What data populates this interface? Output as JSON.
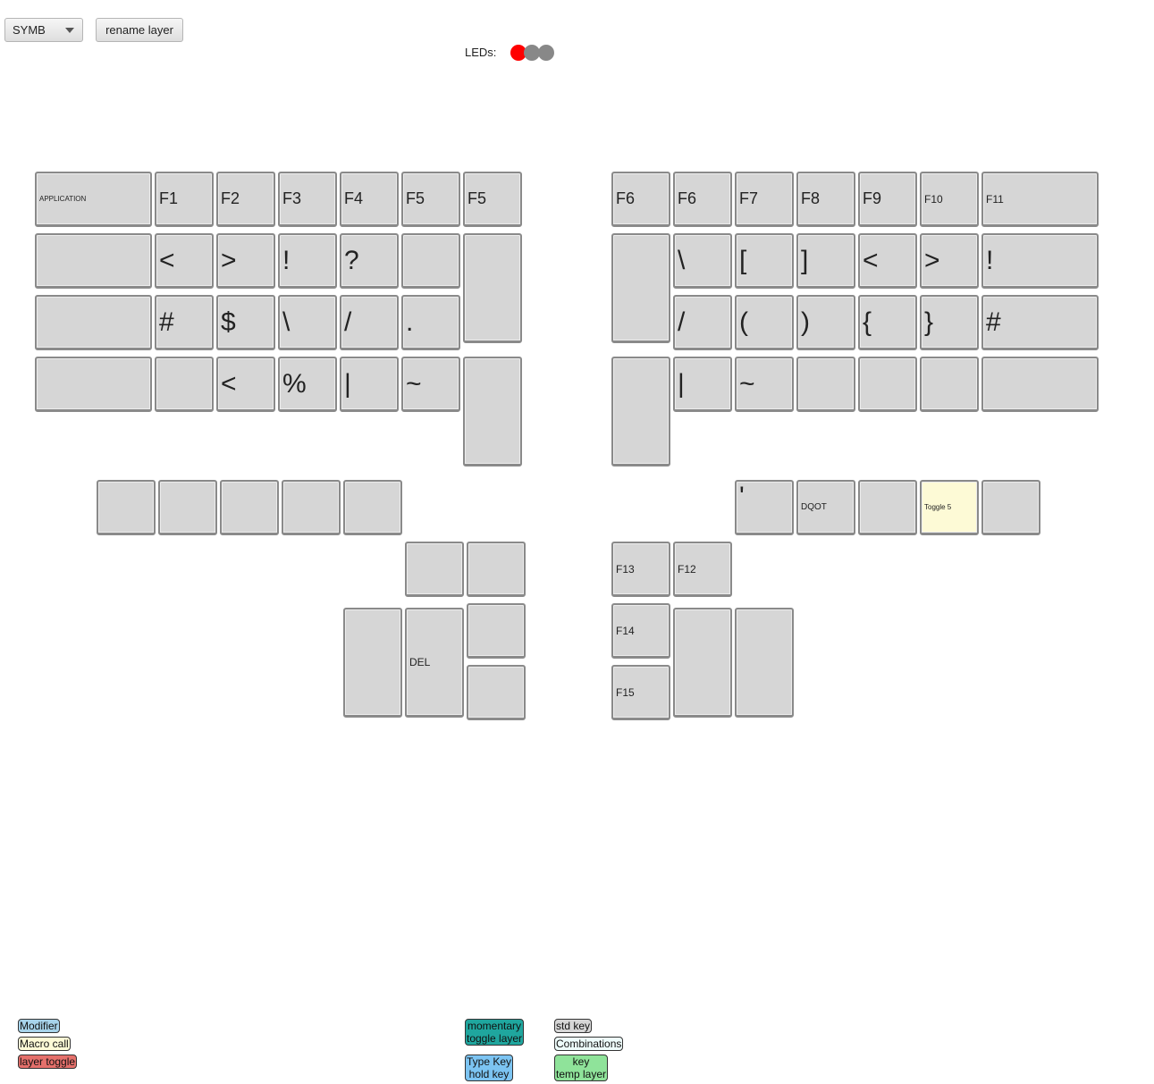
{
  "toolbar": {
    "layer_select_value": "SYMB",
    "rename_label": "rename layer",
    "leds_label": "LEDs:"
  },
  "leds": [
    {
      "name": "led-1",
      "color": "#ff0000"
    },
    {
      "name": "led-2",
      "color": "#888888"
    },
    {
      "name": "led-3",
      "color": "#888888"
    }
  ],
  "keys": {
    "l_r1_c1": "APPLICATION",
    "l_r1_c2": "F1",
    "l_r1_c3": "F2",
    "l_r1_c4": "F3",
    "l_r1_c5": "F4",
    "l_r1_c6": "F5",
    "l_r1_c7": "F5",
    "r_r1_c1": "F6",
    "r_r1_c2": "F6",
    "r_r1_c3": "F7",
    "r_r1_c4": "F8",
    "r_r1_c5": "F9",
    "r_r1_c6": "F10",
    "r_r1_c7": "F11",
    "l_r2_c1": "",
    "l_r2_c2": "<",
    "l_r2_c3": ">",
    "l_r2_c4": "!",
    "l_r2_c5": "?",
    "l_r2_c6": "",
    "l_r2_c7": "",
    "r_r2_c1": "",
    "r_r2_c2": "\\",
    "r_r2_c3": "[",
    "r_r2_c4": "]",
    "r_r2_c5": "<",
    "r_r2_c6": ">",
    "r_r2_c7": "!",
    "l_r3_c1": "",
    "l_r3_c2": "#",
    "l_r3_c3": "$",
    "l_r3_c4": "\\",
    "l_r3_c5": "/",
    "l_r3_c6": ".",
    "r_r3_c2": "/",
    "r_r3_c3": "(",
    "r_r3_c4": ")",
    "r_r3_c5": "{",
    "r_r3_c6": "}",
    "r_r3_c7": "#",
    "l_r4_c1": "",
    "l_r4_c2": "",
    "l_r4_c3": "<",
    "l_r4_c4": "%",
    "l_r4_c5": "|",
    "l_r4_c6": "~",
    "l_r4_c7": "",
    "r_r4_c1": "",
    "r_r4_c2": "|",
    "r_r4_c3": "~",
    "r_r4_c4": "",
    "r_r4_c5": "",
    "r_r4_c6": "",
    "r_r4_c7": "",
    "l_b_c1": "",
    "l_b_c2": "",
    "l_b_c3": "",
    "l_b_c4": "",
    "l_b_c5": "",
    "r_b_c1": "'",
    "r_b_c2": "DQOT",
    "r_b_c3": "",
    "r_b_c4": "Toggle 5",
    "r_b_c5": "",
    "l_t1": "",
    "l_t2": "",
    "l_t3": "",
    "l_t4": "DEL",
    "l_t5": "",
    "l_t6": "",
    "r_t1": "F13",
    "r_t2": "F12",
    "r_t3": "F14",
    "r_t4": "",
    "r_t5": "",
    "r_t6": "F15"
  },
  "legend": {
    "modifier": {
      "label": "Modifier",
      "color": "#a7d3ea"
    },
    "macro": {
      "label": "Macro call",
      "color": "#fdfad6"
    },
    "layer_toggle": {
      "label": "layer toggle",
      "color": "#e5706b"
    },
    "momentary": {
      "label1": "momentary",
      "label2": "toggle layer",
      "color": "#1fa69e"
    },
    "typekey": {
      "label1": "Type Key",
      "label2": "hold key",
      "color": "#7cc4f2"
    },
    "std": {
      "label": "std key",
      "color": "#d6d6d6"
    },
    "combinations": {
      "label": "Combinations",
      "color": "#eefcfb"
    },
    "keytemp": {
      "label1": "key",
      "label2": "temp layer",
      "color": "#8fe39a"
    }
  }
}
